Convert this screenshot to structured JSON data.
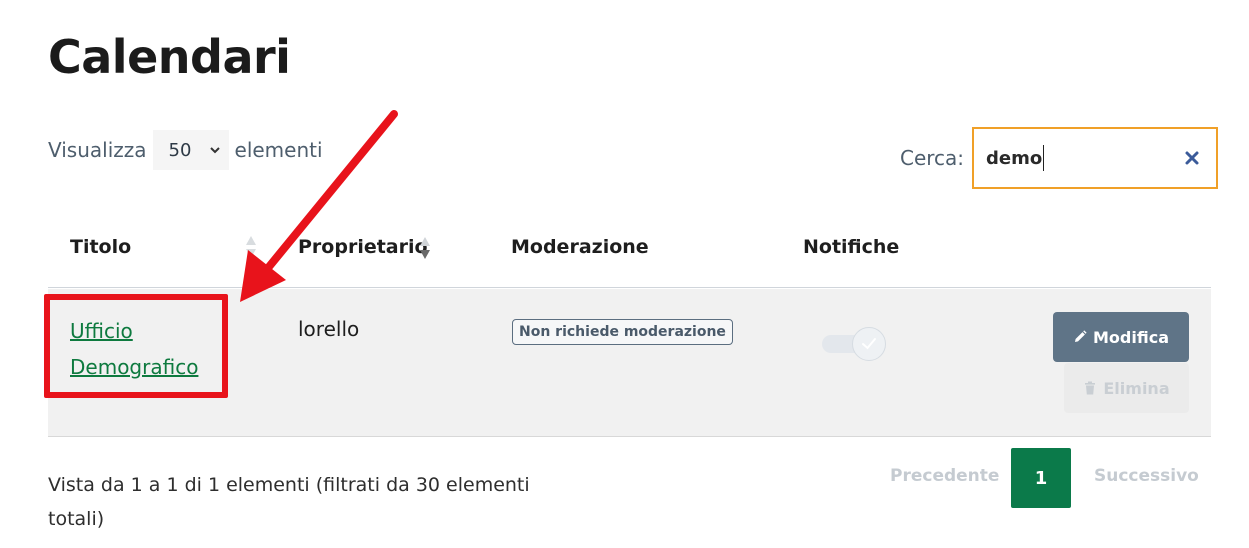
{
  "page": {
    "title": "Calendari"
  },
  "length_control": {
    "prefix": "Visualizza",
    "selected": "50",
    "suffix": "elementi"
  },
  "search": {
    "label": "Cerca:",
    "value": "demo",
    "accent_color": "#f0a028"
  },
  "table": {
    "headers": {
      "title": "Titolo",
      "owner": "Proprietario",
      "moderation": "Moderazione",
      "notifications": "Notifiche"
    },
    "rows": [
      {
        "title_line1": "Ufficio",
        "title_line2": "Demografico",
        "owner": "lorello",
        "moderation": "Non richiede moderazione",
        "notifications_enabled": true,
        "edit_label": "Modifica",
        "delete_label": "Elimina"
      }
    ]
  },
  "footer": {
    "info": "Vista da 1 a 1 di 1 elementi (filtrati da 30 elementi totali)",
    "pagination": {
      "previous": "Precedente",
      "current": "1",
      "next": "Successivo"
    }
  },
  "colors": {
    "link": "#0e7a3f",
    "primary_button": "#5f7487",
    "current_page": "#0b7a4a",
    "annotation": "#e8131b"
  },
  "icons": {
    "select": "chevron-down-icon",
    "clear": "clear-icon",
    "sort": "sort-icon",
    "edit": "pencil-icon",
    "delete": "trash-icon",
    "toggle": "check-icon"
  }
}
